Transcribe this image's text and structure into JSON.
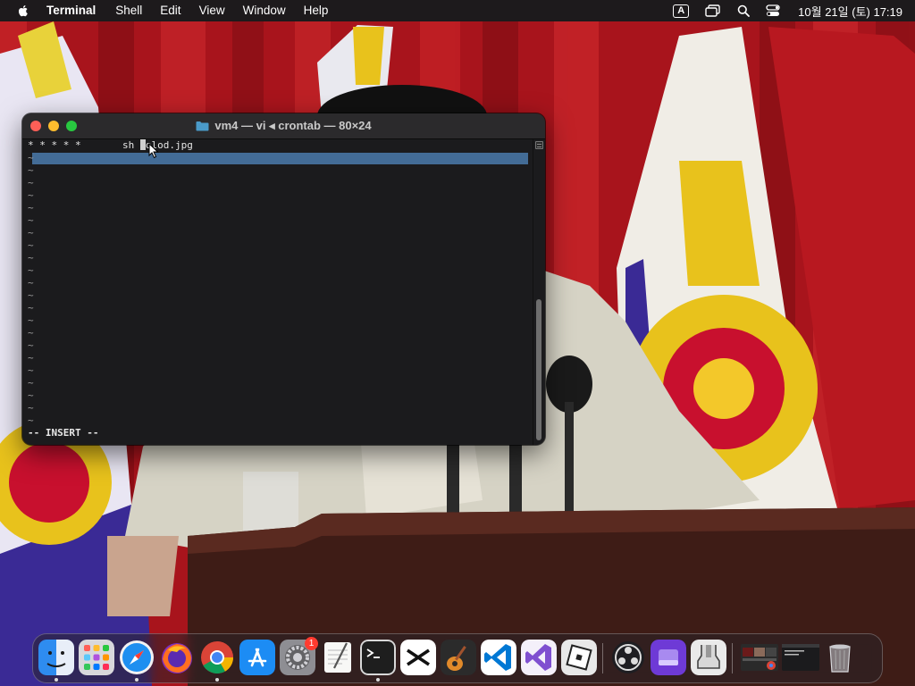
{
  "menubar": {
    "app_name": "Terminal",
    "menus": [
      "Shell",
      "Edit",
      "View",
      "Window",
      "Help"
    ],
    "input_source": "A",
    "clock": "10월 21일 (토) 17:19"
  },
  "terminal": {
    "title": "vm4 — vi ◂ crontab — 80×24",
    "line1_prefix": "* * * * *       sh ",
    "line1_suffix": "olod.jpg",
    "tilde": "~",
    "mode": "-- INSERT --"
  },
  "dock": {
    "apps": [
      {
        "name": "finder",
        "running": true
      },
      {
        "name": "launchpad",
        "running": false
      },
      {
        "name": "safari",
        "running": true
      },
      {
        "name": "firefox",
        "running": false
      },
      {
        "name": "chrome",
        "running": true
      },
      {
        "name": "app-store",
        "running": false
      },
      {
        "name": "system-settings",
        "running": false,
        "badge": "1"
      },
      {
        "name": "textedit",
        "running": false
      },
      {
        "name": "terminal",
        "running": true
      },
      {
        "name": "capcut",
        "running": false
      },
      {
        "name": "garageband",
        "running": false
      },
      {
        "name": "vscode",
        "running": false
      },
      {
        "name": "visual-studio",
        "running": false
      },
      {
        "name": "roblox",
        "running": false
      },
      {
        "name": "obs",
        "running": false
      },
      {
        "name": "storage-app",
        "running": false
      },
      {
        "name": "archive-utility",
        "running": false
      }
    ]
  },
  "colors": {
    "menubar": "#1d1a1c",
    "terminal_bg": "#1b1b1d",
    "titlebar": "#2b2a2c",
    "highlight": "#436c96",
    "close": "#fe5f57",
    "minimize": "#febc2e",
    "maximize": "#28c840",
    "badge": "#ff3b30"
  }
}
